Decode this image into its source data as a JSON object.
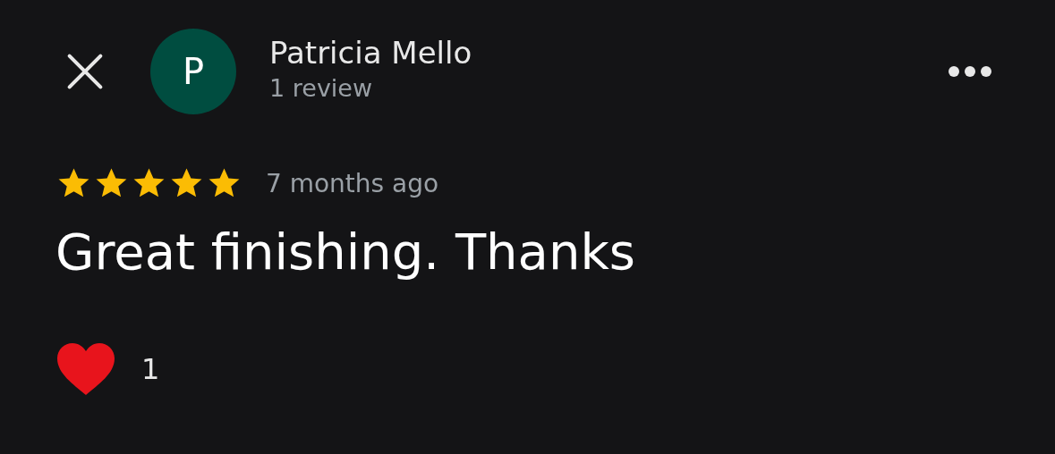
{
  "reviewer": {
    "initial": "P",
    "name": "Patricia Mello",
    "review_count": "1 review"
  },
  "review": {
    "stars": 5,
    "time": "7 months ago",
    "text": "Great finishing. Thanks"
  },
  "reactions": [
    {
      "count": "1"
    }
  ]
}
